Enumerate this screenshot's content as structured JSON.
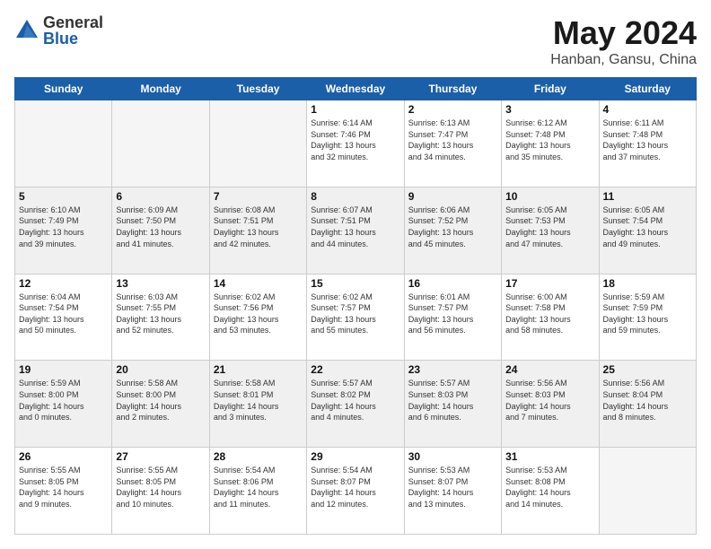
{
  "header": {
    "logo": {
      "general": "General",
      "blue": "Blue"
    },
    "title": "May 2024",
    "location": "Hanban, Gansu, China"
  },
  "weekdays": [
    "Sunday",
    "Monday",
    "Tuesday",
    "Wednesday",
    "Thursday",
    "Friday",
    "Saturday"
  ],
  "weeks": [
    {
      "shaded": false,
      "days": [
        {
          "num": "",
          "info": ""
        },
        {
          "num": "",
          "info": ""
        },
        {
          "num": "",
          "info": ""
        },
        {
          "num": "1",
          "info": "Sunrise: 6:14 AM\nSunset: 7:46 PM\nDaylight: 13 hours\nand 32 minutes."
        },
        {
          "num": "2",
          "info": "Sunrise: 6:13 AM\nSunset: 7:47 PM\nDaylight: 13 hours\nand 34 minutes."
        },
        {
          "num": "3",
          "info": "Sunrise: 6:12 AM\nSunset: 7:48 PM\nDaylight: 13 hours\nand 35 minutes."
        },
        {
          "num": "4",
          "info": "Sunrise: 6:11 AM\nSunset: 7:48 PM\nDaylight: 13 hours\nand 37 minutes."
        }
      ]
    },
    {
      "shaded": true,
      "days": [
        {
          "num": "5",
          "info": "Sunrise: 6:10 AM\nSunset: 7:49 PM\nDaylight: 13 hours\nand 39 minutes."
        },
        {
          "num": "6",
          "info": "Sunrise: 6:09 AM\nSunset: 7:50 PM\nDaylight: 13 hours\nand 41 minutes."
        },
        {
          "num": "7",
          "info": "Sunrise: 6:08 AM\nSunset: 7:51 PM\nDaylight: 13 hours\nand 42 minutes."
        },
        {
          "num": "8",
          "info": "Sunrise: 6:07 AM\nSunset: 7:51 PM\nDaylight: 13 hours\nand 44 minutes."
        },
        {
          "num": "9",
          "info": "Sunrise: 6:06 AM\nSunset: 7:52 PM\nDaylight: 13 hours\nand 45 minutes."
        },
        {
          "num": "10",
          "info": "Sunrise: 6:05 AM\nSunset: 7:53 PM\nDaylight: 13 hours\nand 47 minutes."
        },
        {
          "num": "11",
          "info": "Sunrise: 6:05 AM\nSunset: 7:54 PM\nDaylight: 13 hours\nand 49 minutes."
        }
      ]
    },
    {
      "shaded": false,
      "days": [
        {
          "num": "12",
          "info": "Sunrise: 6:04 AM\nSunset: 7:54 PM\nDaylight: 13 hours\nand 50 minutes."
        },
        {
          "num": "13",
          "info": "Sunrise: 6:03 AM\nSunset: 7:55 PM\nDaylight: 13 hours\nand 52 minutes."
        },
        {
          "num": "14",
          "info": "Sunrise: 6:02 AM\nSunset: 7:56 PM\nDaylight: 13 hours\nand 53 minutes."
        },
        {
          "num": "15",
          "info": "Sunrise: 6:02 AM\nSunset: 7:57 PM\nDaylight: 13 hours\nand 55 minutes."
        },
        {
          "num": "16",
          "info": "Sunrise: 6:01 AM\nSunset: 7:57 PM\nDaylight: 13 hours\nand 56 minutes."
        },
        {
          "num": "17",
          "info": "Sunrise: 6:00 AM\nSunset: 7:58 PM\nDaylight: 13 hours\nand 58 minutes."
        },
        {
          "num": "18",
          "info": "Sunrise: 5:59 AM\nSunset: 7:59 PM\nDaylight: 13 hours\nand 59 minutes."
        }
      ]
    },
    {
      "shaded": true,
      "days": [
        {
          "num": "19",
          "info": "Sunrise: 5:59 AM\nSunset: 8:00 PM\nDaylight: 14 hours\nand 0 minutes."
        },
        {
          "num": "20",
          "info": "Sunrise: 5:58 AM\nSunset: 8:00 PM\nDaylight: 14 hours\nand 2 minutes."
        },
        {
          "num": "21",
          "info": "Sunrise: 5:58 AM\nSunset: 8:01 PM\nDaylight: 14 hours\nand 3 minutes."
        },
        {
          "num": "22",
          "info": "Sunrise: 5:57 AM\nSunset: 8:02 PM\nDaylight: 14 hours\nand 4 minutes."
        },
        {
          "num": "23",
          "info": "Sunrise: 5:57 AM\nSunset: 8:03 PM\nDaylight: 14 hours\nand 6 minutes."
        },
        {
          "num": "24",
          "info": "Sunrise: 5:56 AM\nSunset: 8:03 PM\nDaylight: 14 hours\nand 7 minutes."
        },
        {
          "num": "25",
          "info": "Sunrise: 5:56 AM\nSunset: 8:04 PM\nDaylight: 14 hours\nand 8 minutes."
        }
      ]
    },
    {
      "shaded": false,
      "days": [
        {
          "num": "26",
          "info": "Sunrise: 5:55 AM\nSunset: 8:05 PM\nDaylight: 14 hours\nand 9 minutes."
        },
        {
          "num": "27",
          "info": "Sunrise: 5:55 AM\nSunset: 8:05 PM\nDaylight: 14 hours\nand 10 minutes."
        },
        {
          "num": "28",
          "info": "Sunrise: 5:54 AM\nSunset: 8:06 PM\nDaylight: 14 hours\nand 11 minutes."
        },
        {
          "num": "29",
          "info": "Sunrise: 5:54 AM\nSunset: 8:07 PM\nDaylight: 14 hours\nand 12 minutes."
        },
        {
          "num": "30",
          "info": "Sunrise: 5:53 AM\nSunset: 8:07 PM\nDaylight: 14 hours\nand 13 minutes."
        },
        {
          "num": "31",
          "info": "Sunrise: 5:53 AM\nSunset: 8:08 PM\nDaylight: 14 hours\nand 14 minutes."
        },
        {
          "num": "",
          "info": ""
        }
      ]
    }
  ]
}
